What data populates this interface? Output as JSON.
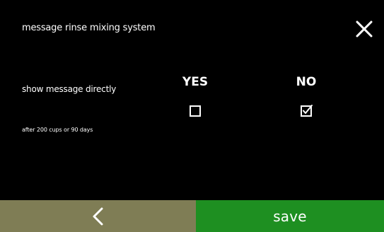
{
  "header": {
    "title": "message rinse mixing system",
    "close_icon": "close-icon"
  },
  "setting": {
    "label": "show message directly",
    "note": "after 200 cups or 90 days"
  },
  "options": {
    "yes": {
      "label": "YES",
      "checked": false
    },
    "no": {
      "label": "NO",
      "checked": true
    }
  },
  "footer": {
    "back_icon": "chevron-left-icon",
    "save_label": "save"
  },
  "colors": {
    "background": "#000000",
    "text": "#ffffff",
    "back_button": "#7f7d55",
    "save_button": "#1e8f21"
  }
}
